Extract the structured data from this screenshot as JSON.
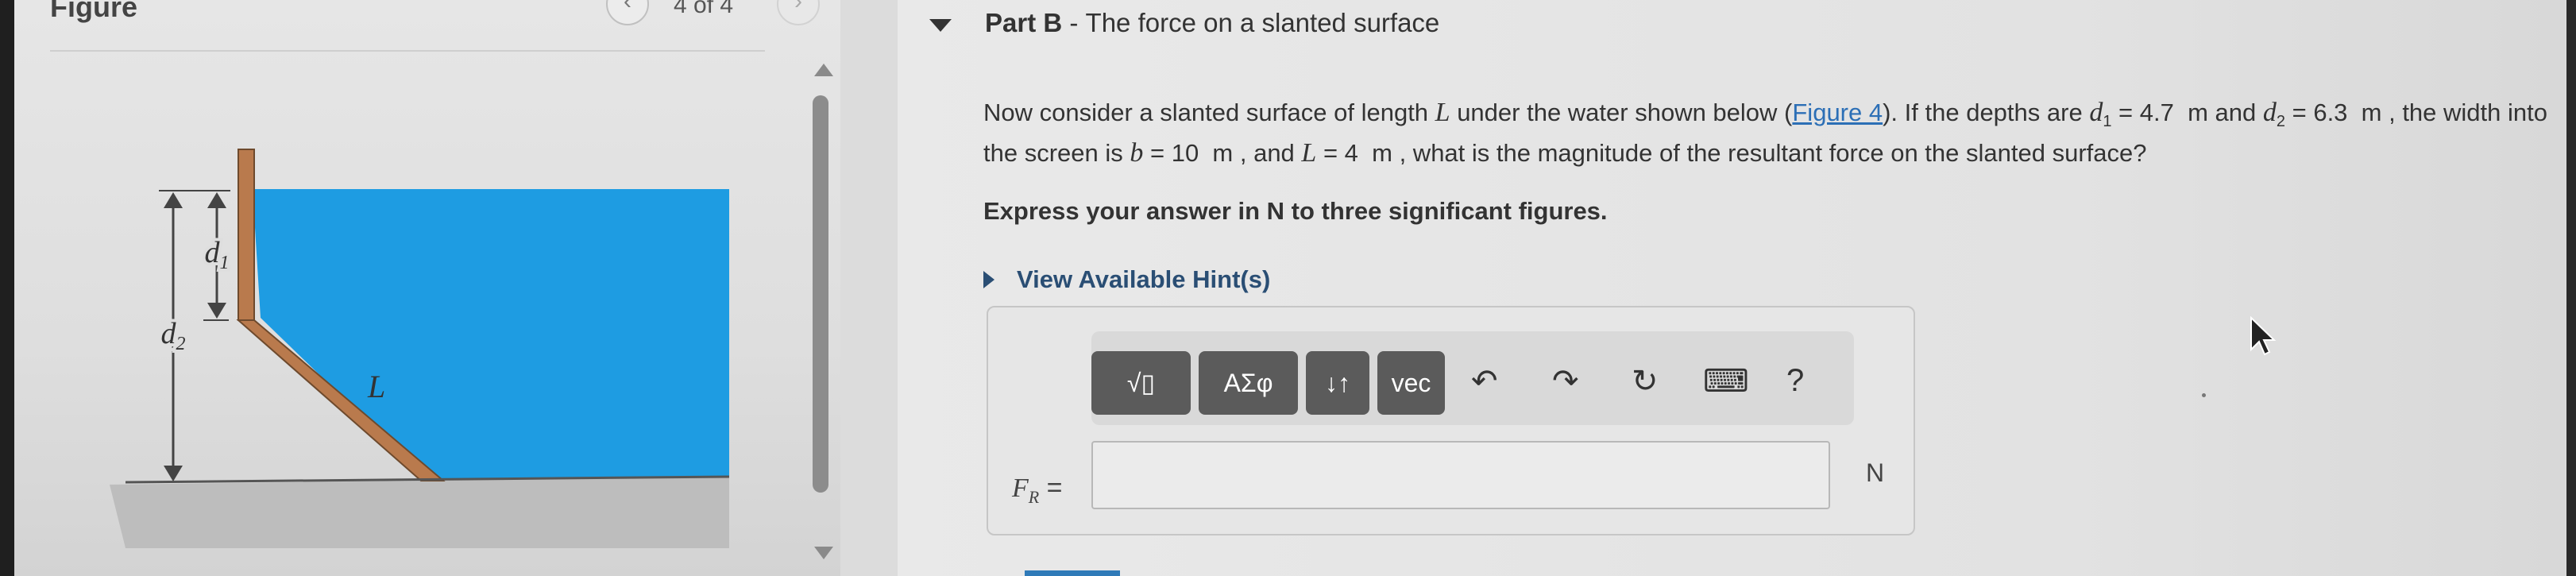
{
  "figure_panel": {
    "title": "Figure",
    "pager": "4 of 4",
    "diagram_labels": {
      "d1": "d",
      "d1_sub": "1",
      "d2": "d",
      "d2_sub": "2",
      "L": "L"
    }
  },
  "part": {
    "label": "Part B",
    "separator": " - ",
    "title": "The force on a slanted surface"
  },
  "question": {
    "t1": "Now consider a slanted surface of length ",
    "L": "L",
    "t2": " under the water shown below (",
    "figure_link": "Figure 4",
    "t3": "). If the depths are ",
    "d1_var": "d",
    "d1_sub": "1",
    "d1_val": " = 4.7  m",
    "t4": " and ",
    "d2_var": "d",
    "d2_sub": "2",
    "d2_val": " = 6.3  m",
    "t5": " , the width into the screen is ",
    "b_var": "b",
    "b_val": " = 10  m",
    "t6": " , and ",
    "L2": "L",
    "L_val": " = 4  m",
    "t7": " , what is the magnitude of the resultant force on the slanted surface?"
  },
  "instruction": "Express your answer in N to three significant figures.",
  "hint_label": "View Available Hint(s)",
  "toolbar": {
    "templates": "√▯",
    "greek": "ΑΣφ",
    "arrows": "↓↑",
    "vec": "vec",
    "undo": "↶",
    "redo": "↷",
    "reset": "↻",
    "keyboard": "⌨",
    "help": "?"
  },
  "answer": {
    "var": "F",
    "sub": "R",
    "eq": " =",
    "value": "",
    "unit": "N"
  },
  "colors": {
    "water": "#1e9ce2",
    "wall": "#b97a4d",
    "link": "#2c6fb6",
    "toolbar_button": "#5b5b5b"
  }
}
